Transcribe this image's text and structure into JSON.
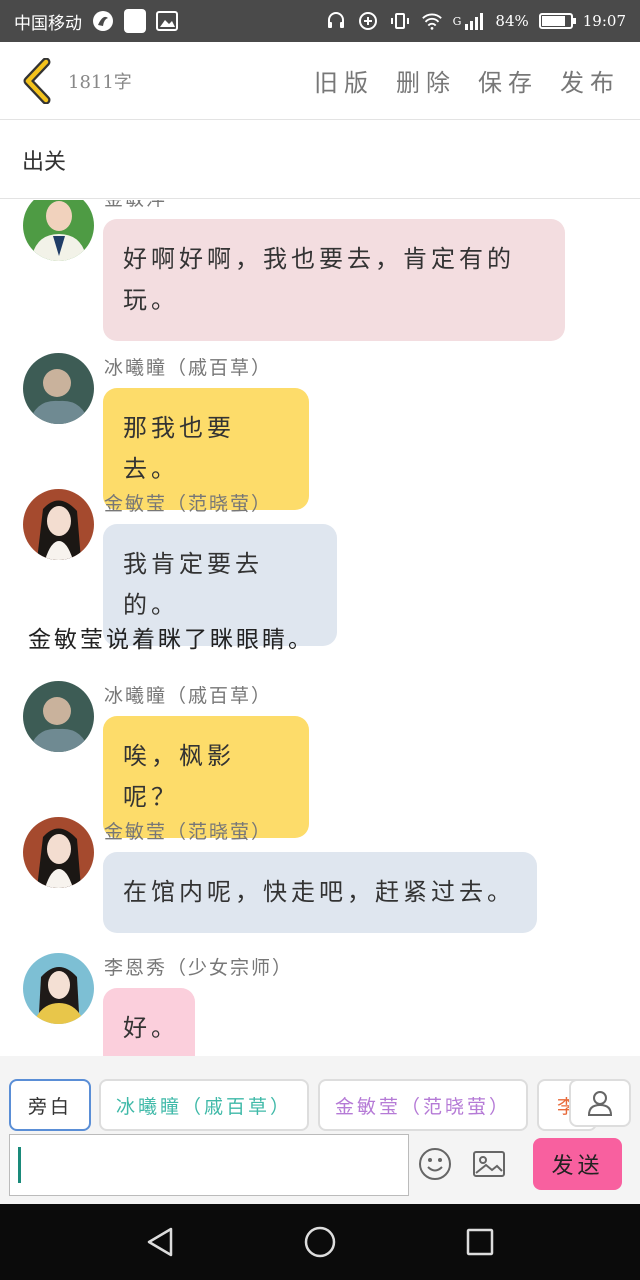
{
  "statusbar": {
    "carrier": "中国移动",
    "network": "G",
    "battery": "84%",
    "battery_level": 0.84,
    "time": "19:07"
  },
  "toolbar": {
    "word_count": "1811字",
    "actions": [
      "旧版",
      "删除",
      "保存",
      "发布"
    ]
  },
  "title": "出关",
  "messages": [
    {
      "name": "金敏萍",
      "text": "好啊好啊，我也要去，肯定有的玩。",
      "bubble_color": "#f3dde0",
      "avatar_color": "#3f8f3a"
    },
    {
      "name": "冰曦瞳（戚百草）",
      "text": "那我也要去。",
      "bubble_color": "#fddc6a",
      "avatar_color": "#3b5f52"
    },
    {
      "name": "金敏莹（范晓萤）",
      "text": "我肯定要去的。",
      "bubble_color": "#dfe6ef",
      "avatar_color": "#5a3a2f"
    },
    {
      "narration": "金敏莹说着眯了眯眼睛。"
    },
    {
      "name": "冰曦瞳（戚百草）",
      "text": "唉，枫影呢？",
      "bubble_color": "#fddc6a",
      "avatar_color": "#3b5f52"
    },
    {
      "name": "金敏莹（范晓萤）",
      "text": "在馆内呢，快走吧，赶紧过去。",
      "bubble_color": "#dfe6ef",
      "avatar_color": "#5a3a2f"
    },
    {
      "name": "李恩秀（少女宗师）",
      "text": "好。",
      "bubble_color": "#fbcfdc",
      "avatar_color": "#6fb3c9"
    }
  ],
  "characters": [
    {
      "label": "旁白",
      "color": "#333333"
    },
    {
      "label": "冰曦瞳（戚百草）",
      "color": "#3fb9a8"
    },
    {
      "label": "金敏莹（范晓萤）",
      "color": "#b57ad6"
    },
    {
      "label": "李",
      "color": "#e86a3a"
    }
  ],
  "input": {
    "send_label": "发送",
    "emoji_icon": "smile-icon",
    "image_icon": "image-icon"
  }
}
